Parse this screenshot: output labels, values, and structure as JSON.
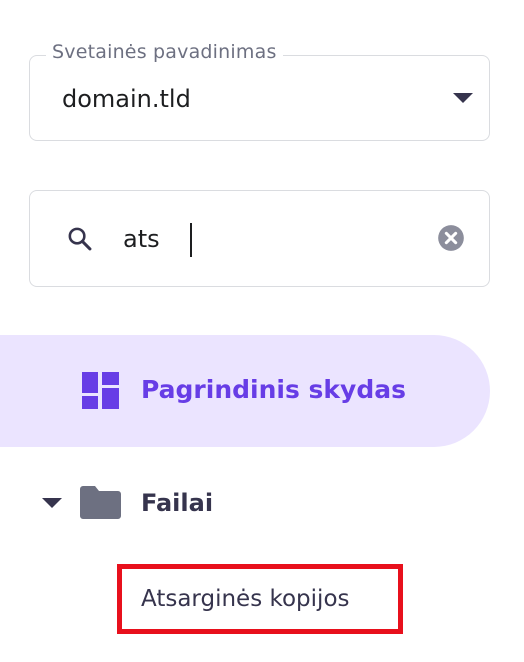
{
  "website_select": {
    "label": "Svetainės pavadinimas",
    "value": "domain.tld"
  },
  "search": {
    "value": "ats",
    "icon": "search-icon",
    "clear_icon": "clear-circle-icon"
  },
  "nav": {
    "dashboard": {
      "label": "Pagrindinis skydas",
      "icon": "dashboard-grid-icon",
      "active": true
    },
    "files": {
      "label": "Failai",
      "icon": "folder-icon",
      "expanded": true,
      "children": [
        {
          "label": "Atsarginės kopijos",
          "highlighted": true
        }
      ]
    }
  },
  "colors": {
    "accent": "#673de6",
    "active_bg": "#ebe4ff",
    "text_primary": "#1d1e20",
    "text_secondary": "#36344d",
    "highlight_border": "#e8101c"
  }
}
